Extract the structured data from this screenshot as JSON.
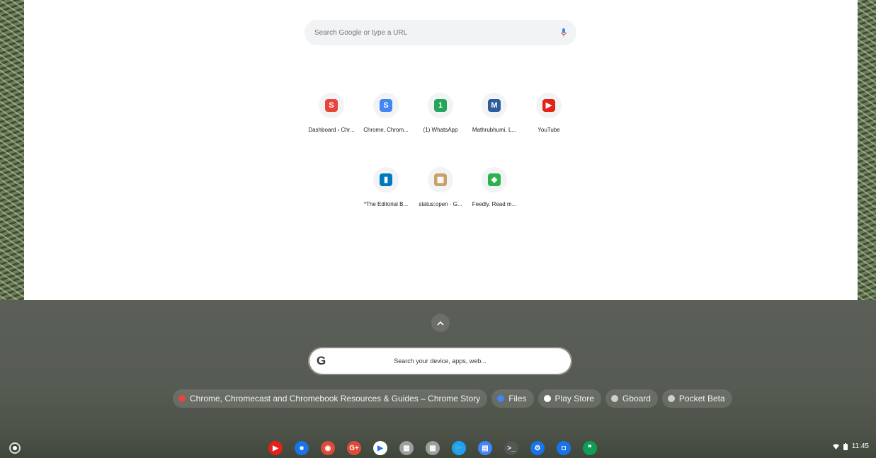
{
  "ntp": {
    "search_placeholder": "Search Google or type a URL",
    "tiles_row1": [
      {
        "label": "Dashboard ‹ Chr...",
        "icon": "chrome-story-icon",
        "color": "#e8453c"
      },
      {
        "label": "Chrome, Chrom...",
        "icon": "chrome-story-icon",
        "color": "#4285f4"
      },
      {
        "label": "(1) WhatsApp",
        "icon": "whatsapp-icon",
        "color": "#25a55a"
      },
      {
        "label": "Mathrubhumi, L...",
        "icon": "mathrubhumi-icon",
        "color": "#2c5e9e"
      },
      {
        "label": "YouTube",
        "icon": "youtube-icon",
        "color": "#e62117"
      }
    ],
    "tiles_row2": [
      {
        "label": "*The Editorial B...",
        "icon": "trello-icon",
        "color": "#0079bf"
      },
      {
        "label": "status:open · G...",
        "icon": "gerrit-icon",
        "color": "#c7a06b"
      },
      {
        "label": "Feedly. Read m...",
        "icon": "feedly-icon",
        "color": "#2bb24c"
      }
    ]
  },
  "launcher": {
    "search_placeholder": "Search your device, apps, web...",
    "g_letter": "G",
    "chips": [
      {
        "label": "Chrome, Chromecast and Chromebook Resources & Guides – Chrome Story",
        "icon": "chrome-story-icon",
        "color": "#e8453c"
      },
      {
        "label": "Files",
        "icon": "files-icon",
        "color": "#4285f4"
      },
      {
        "label": "Play Store",
        "icon": "play-store-icon",
        "color": "#ffffff"
      },
      {
        "label": "Gboard",
        "icon": "gboard-icon",
        "color": "#cfcfcf"
      },
      {
        "label": "Pocket Beta",
        "icon": "pocket-icon",
        "color": "#cfcfcf"
      }
    ]
  },
  "shelf": {
    "apps": [
      {
        "name": "youtube-icon",
        "color": "#e62117",
        "glyph": "▶"
      },
      {
        "name": "files-icon",
        "color": "#1a73e8",
        "glyph": "■"
      },
      {
        "name": "chrome-icon",
        "color": "#dd4b39",
        "glyph": "◉"
      },
      {
        "name": "google-plus-icon",
        "color": "#dd4b39",
        "glyph": "G+"
      },
      {
        "name": "play-store-icon",
        "color": "#ffffff",
        "glyph": "▶"
      },
      {
        "name": "app-grey-1-icon",
        "color": "#9e9e9e",
        "glyph": "▦"
      },
      {
        "name": "app-grey-2-icon",
        "color": "#9e9e9e",
        "glyph": "▦"
      },
      {
        "name": "twitter-icon",
        "color": "#1da1f2",
        "glyph": "🐦"
      },
      {
        "name": "docs-icon",
        "color": "#4285f4",
        "glyph": "▤"
      },
      {
        "name": "terminal-icon",
        "color": "#555555",
        "glyph": ">_"
      },
      {
        "name": "settings-icon",
        "color": "#1a73e8",
        "glyph": "⚙"
      },
      {
        "name": "camera-icon",
        "color": "#1a73e8",
        "glyph": "◘"
      },
      {
        "name": "hangouts-icon",
        "color": "#0f9d58",
        "glyph": "❞"
      }
    ],
    "time": "11:45"
  }
}
